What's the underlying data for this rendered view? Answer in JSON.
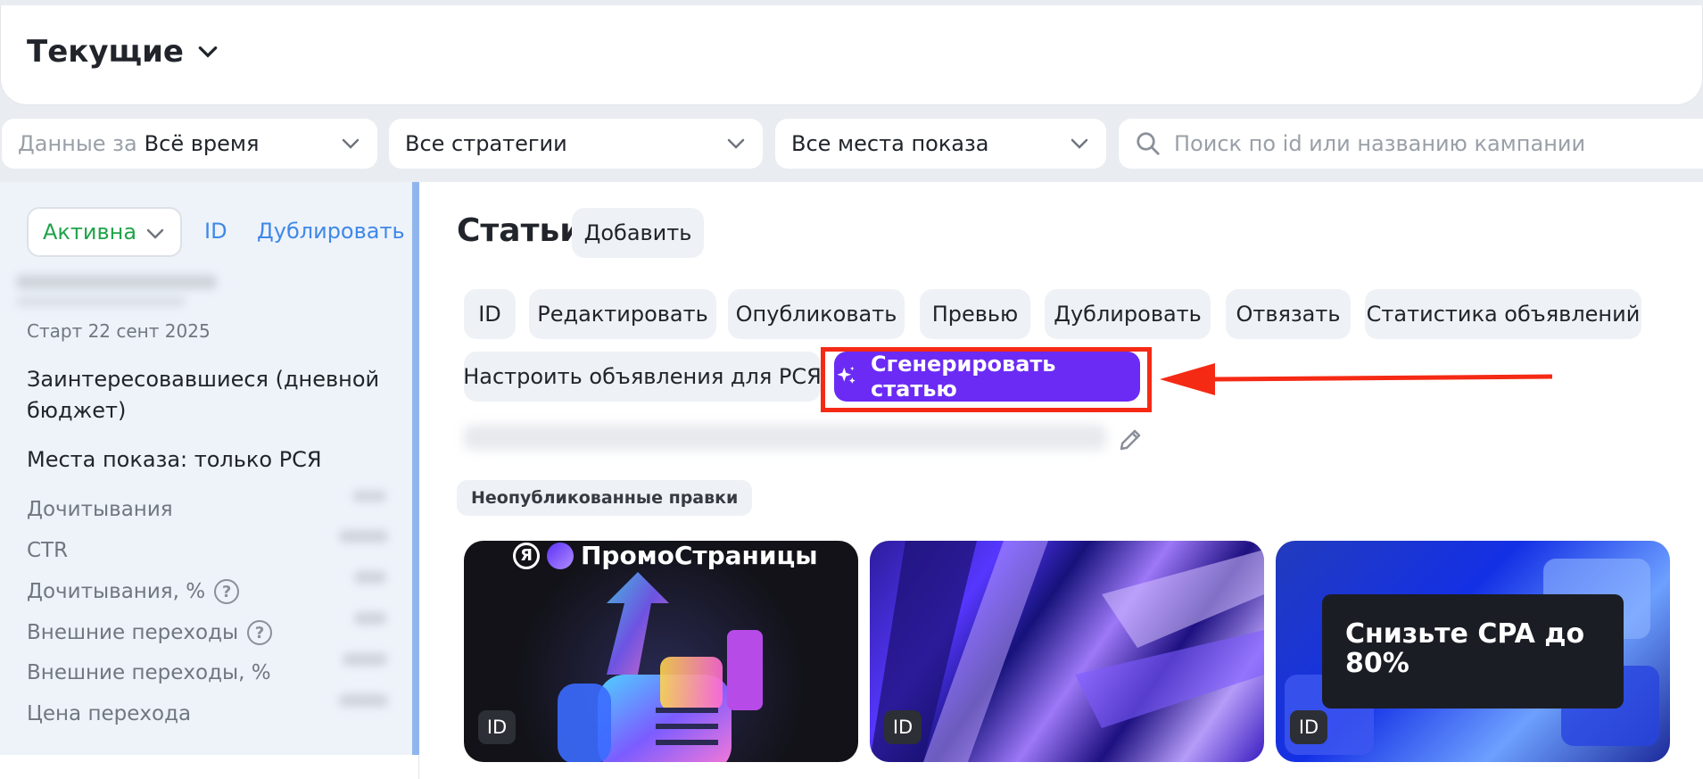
{
  "header": {
    "title": "Текущие"
  },
  "filters": {
    "period_label": "Данные за",
    "period_value": "Всё время",
    "strategies": "Все стратегии",
    "placements": "Все места показа",
    "search_placeholder": "Поиск по id или названию кампании"
  },
  "sidebar": {
    "status": "Активна",
    "id_link": "ID",
    "duplicate_link": "Дублировать",
    "start": "Старт 22 сент 2025",
    "strategy": "Заинтересовавшиеся (дневной бюджет)",
    "placements": "Места показа: только РСЯ",
    "metrics": [
      {
        "label": "Дочитывания",
        "help": false
      },
      {
        "label": "CTR",
        "help": false
      },
      {
        "label": "Дочитывания, %",
        "help": true
      },
      {
        "label": "Внешние переходы",
        "help": true
      },
      {
        "label": "Внешние переходы, %",
        "help": false
      },
      {
        "label": "Цена перехода",
        "help": false
      }
    ],
    "help_glyph": "?"
  },
  "main": {
    "title": "Статьи",
    "add_button": "Добавить",
    "actions": [
      "ID",
      "Редактировать",
      "Опубликовать",
      "Превью",
      "Дублировать",
      "Отвязать",
      "Статистика объявлений",
      "Настроить объявления для РСЯ"
    ],
    "generate_button": "Сгенерировать статью",
    "unpublished_badge": "Неопубликованные правки",
    "cards": [
      {
        "id_label": "ID",
        "logo_circle": "Я",
        "logo_text": "ПромоСтраницы"
      },
      {
        "id_label": "ID"
      },
      {
        "id_label": "ID",
        "headline": "Снизьте CPA до 80%"
      }
    ]
  },
  "colors": {
    "accent": "#6b2bf5",
    "highlight": "#f52a15",
    "link": "#3f88e8",
    "active": "#1fa34a"
  }
}
